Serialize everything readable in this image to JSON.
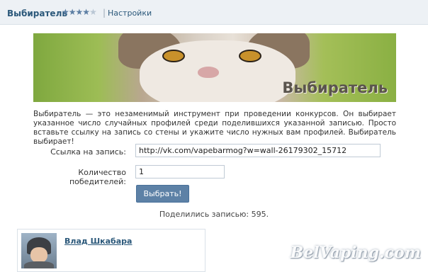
{
  "header": {
    "app_title": "Выбиратель",
    "rating": {
      "value": 4,
      "max": 5
    },
    "separator": "|",
    "settings_label": "Настройки"
  },
  "banner": {
    "title": "Выбиратель"
  },
  "description": "Выбиратель — это незаменимый инструмент при проведении конкурсов. Он выбирает указанное число случайных профилей среди поделившихся указанной записью. Просто вставьте ссылку на запись со стены и укажите число нужных вам профилей. Выбиратель выбирает!",
  "form": {
    "link_label": "Ссылка на запись:",
    "link_value": "http://vk.com/vapebarmog?w=wall-26179302_15712",
    "count_label": "Количество победителей:",
    "count_value": "1",
    "submit_label": "Выбрать!"
  },
  "shared_text": "Поделились записью: 595.",
  "winner": {
    "name": "Влад Шкабара"
  },
  "watermark": "BelVaping.com",
  "colors": {
    "link": "#2b587a",
    "button": "#5d81a6",
    "topbar": "#edf1f5"
  }
}
